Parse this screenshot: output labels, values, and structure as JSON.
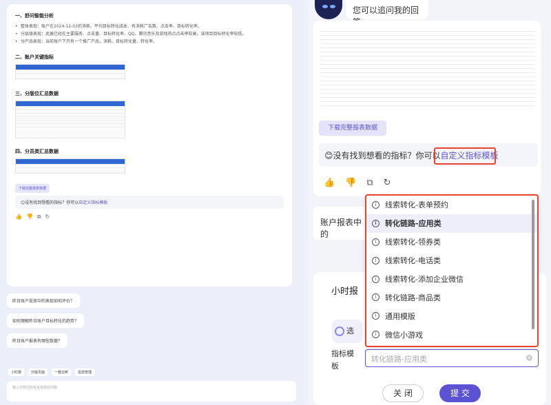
{
  "left": {
    "section1_title": "一、舒问智能分析",
    "bullets": [
      "整体表现：账户在2024-12-03的消耗、平均目标转化成本、有消耗广告数、点击率、目标转化率。",
      "分层级表现：武器已经在主要服务、点击量、目标转化率、QQ、腾讯音乐及游戏热点点击率较高，该项目目标转化率较低。",
      "分产品表现：当前账户下只有一个推广产品，消耗、目标转化量、转化率。"
    ],
    "section2_title": "二、账户关键指标",
    "section3_title": "三、分版位汇总数据",
    "section4_title": "四、分员类汇总数据",
    "download": "下载完整报表数据",
    "notfound_prefix": "😊没有找到想看的指标？你可以",
    "notfound_link": "自定义指标模板",
    "questions": [
      "昨日账户投放中的表现如何评价？",
      "如何理解昨日账户目标转化的趋势？",
      "昨日账户报表有哪些数据？"
    ],
    "tools": [
      "小时报",
      "分版页面",
      "一键诊断",
      "投放管理"
    ],
    "input_placeholder": "输入你想问的有关投放的问题"
  },
  "right": {
    "bubble": "您可以追问我的回答",
    "download": "下载完整报表数据",
    "notfound_prefix": "😊没有找到想看的指标？你可以",
    "notfound_link": "自定义指标模板",
    "side_text": "账户报表中的",
    "panel_title": "小时报",
    "badge": "选",
    "field_label": "指标模板",
    "field_value": "转化链路-应用类",
    "dropdown": [
      "线索转化-表单预约",
      "转化链路-应用类",
      "线索转化-领券类",
      "线索转化-电话类",
      "线索转化-添加企业微信",
      "转化链路-商品类",
      "通用模版",
      "微信小游戏"
    ],
    "selected_index": 1,
    "cancel": "关 闭",
    "submit": "提 交"
  },
  "colors": {
    "accent": "#5b53d4",
    "highlight": "#e8432f"
  }
}
